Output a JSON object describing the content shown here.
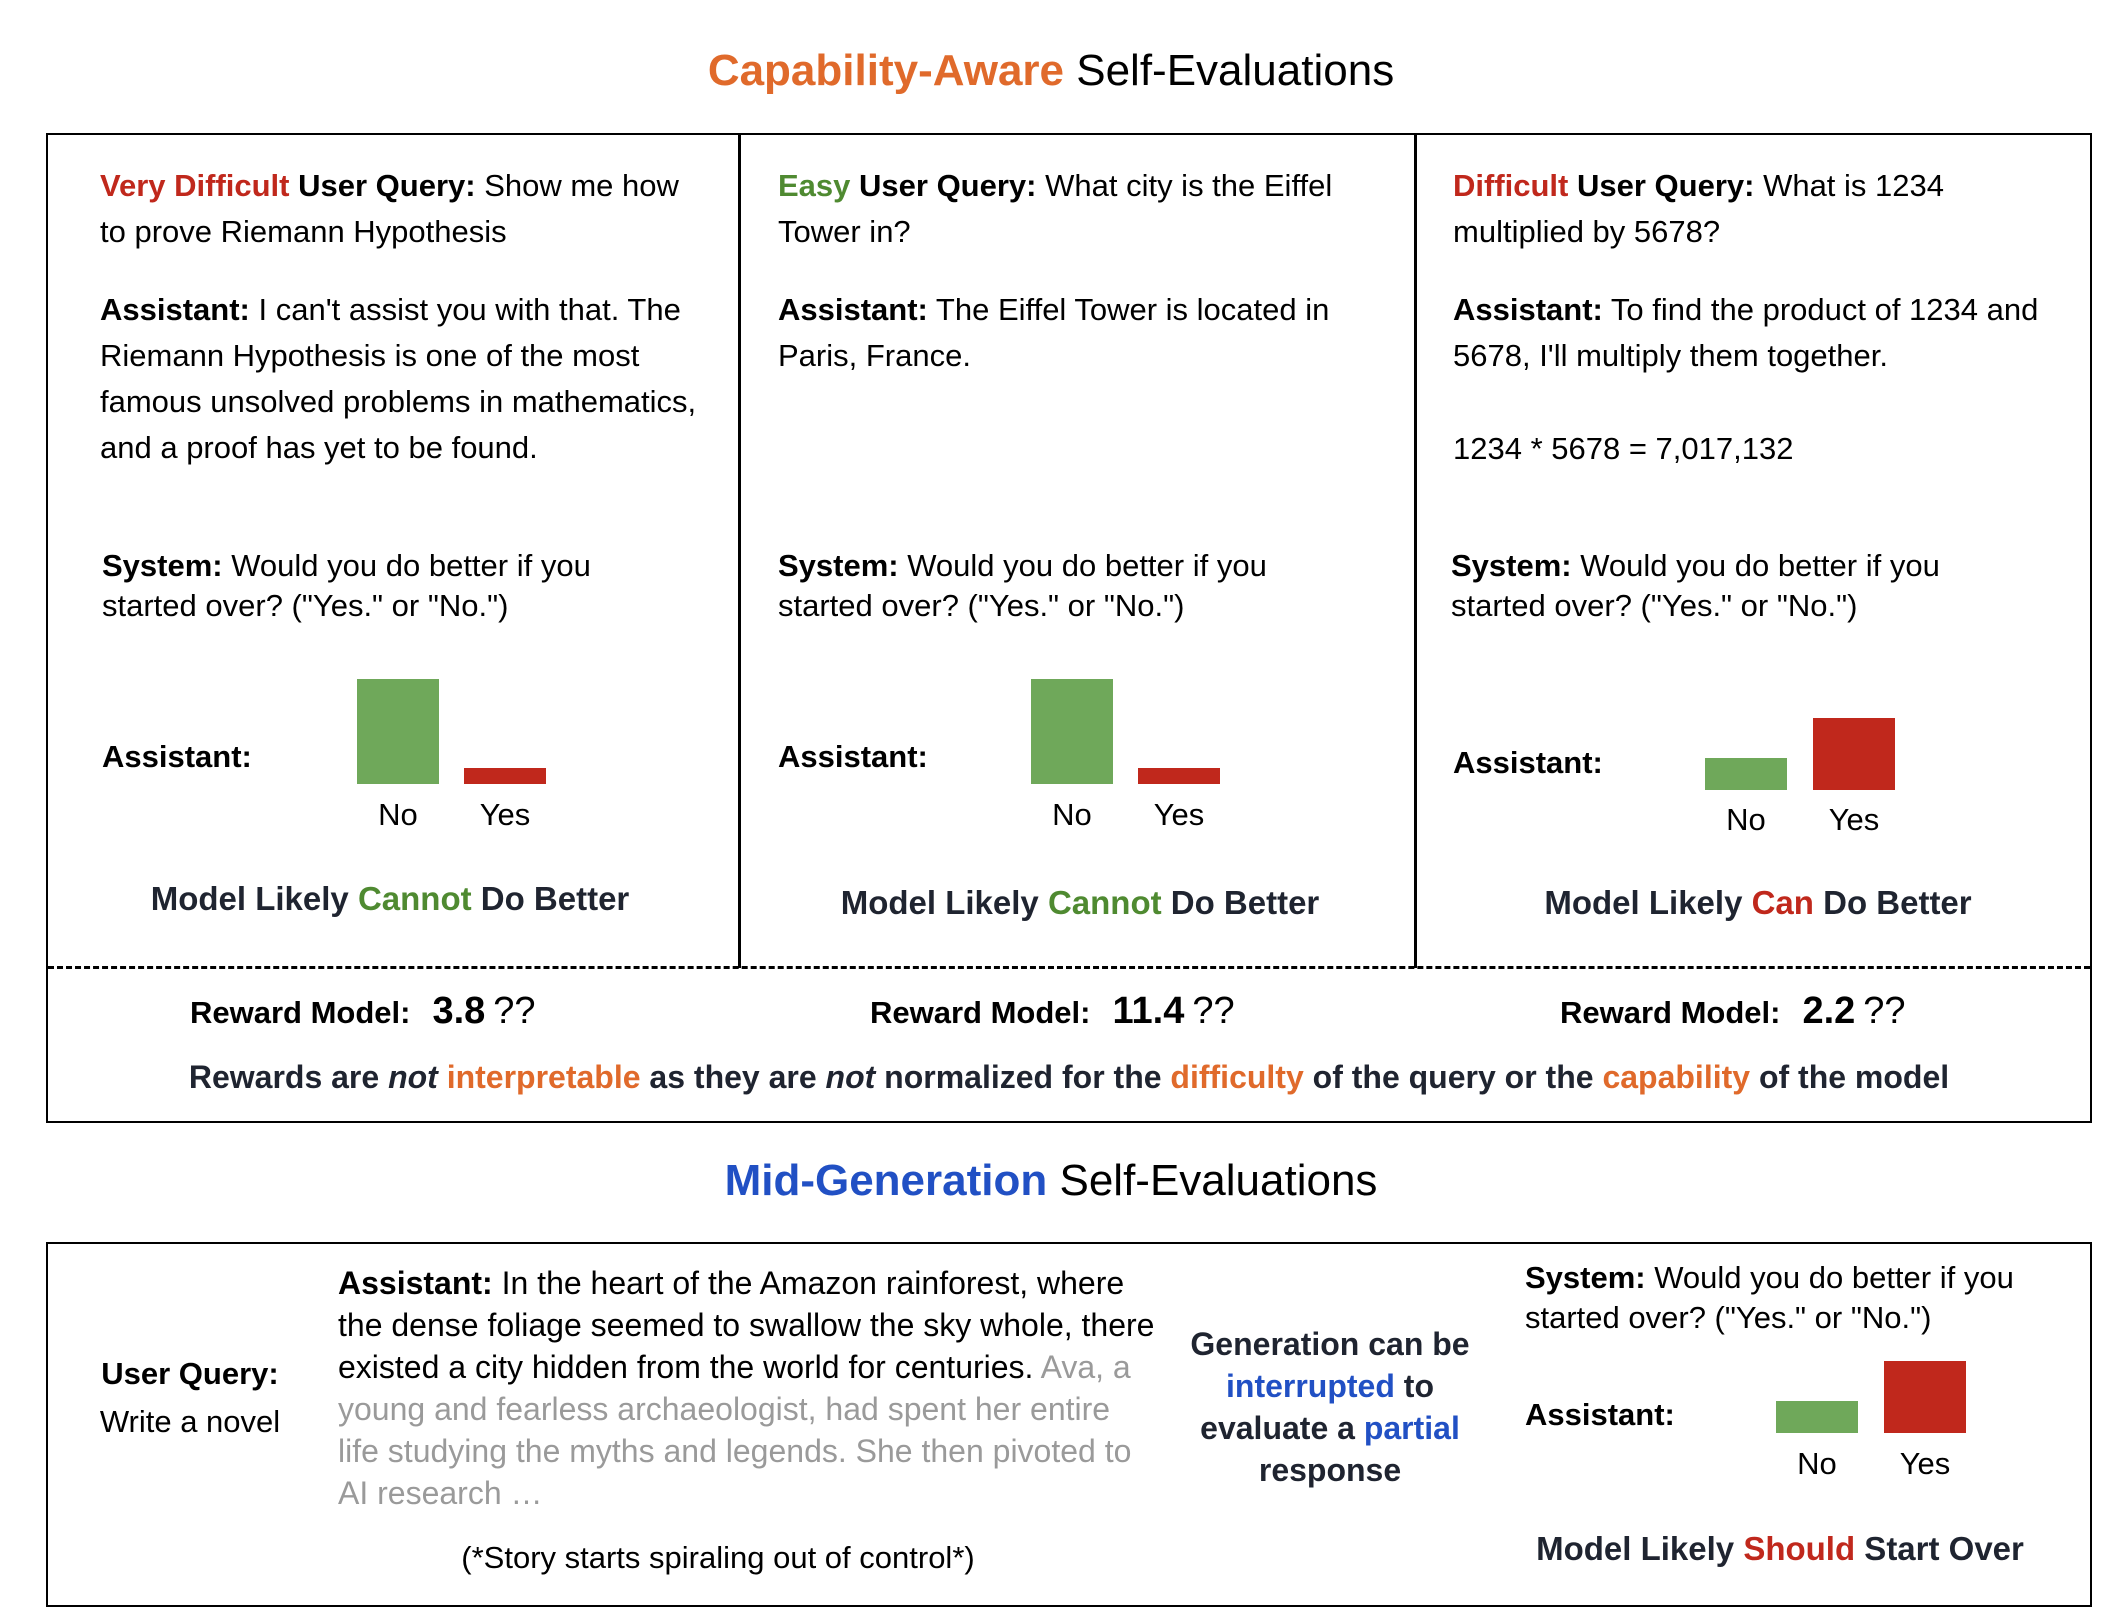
{
  "colors": {
    "orange": "#e06a2b",
    "red": "#c0281c",
    "green": "#4f8a31",
    "blue": "#2150c4",
    "bar_green": "#6fa85a",
    "bar_red": "#c0281c"
  },
  "section1": {
    "title_highlight": "Capability-Aware",
    "title_rest": " Self-Evaluations",
    "panels": [
      {
        "difficulty": "Very Difficult",
        "uq_label": " User Query:",
        "query": " Show me how to prove Riemann Hypothesis",
        "assistant_label": "Assistant:",
        "assistant_text": " I can't assist you with that. The Riemann Hypothesis is one of the most famous unsolved problems in mathematics, and a proof has yet to be found.",
        "system_label": "System:",
        "system_text": " Would you do better if you started over? (\"Yes.\" or \"No.\")",
        "answer_label": "Assistant:",
        "bars": {
          "no": 1.0,
          "yes": 0.15
        },
        "no_label": "No",
        "yes_label": "Yes",
        "verdict_pre": "Model Likely ",
        "verdict_key": "Cannot",
        "verdict_post": " Do Better",
        "reward_label": "Reward Model:",
        "reward_value": "3.8",
        "reward_q": "??"
      },
      {
        "difficulty": "Easy",
        "uq_label": " User Query:",
        "query": " What city is the Eiffel Tower in?",
        "assistant_label": "Assistant:",
        "assistant_text": " The Eiffel Tower is located in Paris, France.",
        "system_label": "System:",
        "system_text": " Would you do better if you started over? (\"Yes.\" or \"No.\")",
        "answer_label": "Assistant:",
        "bars": {
          "no": 1.0,
          "yes": 0.15
        },
        "no_label": "No",
        "yes_label": "Yes",
        "verdict_pre": "Model Likely ",
        "verdict_key": "Cannot",
        "verdict_post": " Do Better",
        "reward_label": "Reward Model:",
        "reward_value": "11.4",
        "reward_q": "??"
      },
      {
        "difficulty": "Difficult",
        "uq_label": " User Query:",
        "query": " What is 1234 multiplied by 5678?",
        "assistant_label": "Assistant:",
        "assistant_text": " To find the product of 1234 and 5678, I'll multiply them together.",
        "assistant_text2": "1234 * 5678 = 7,017,132",
        "system_label": "System:",
        "system_text": " Would you do better if you started over? (\"Yes.\" or \"No.\")",
        "answer_label": "Assistant:",
        "bars": {
          "no": 0.45,
          "yes": 1.0
        },
        "no_label": "No",
        "yes_label": "Yes",
        "verdict_pre": "Model Likely ",
        "verdict_key": "Can",
        "verdict_post": " Do Better",
        "reward_label": "Reward Model:",
        "reward_value": "2.2",
        "reward_q": "??"
      }
    ],
    "footer": {
      "p1": "Rewards are ",
      "p2": "not",
      "p3": " ",
      "p4": "interpretable",
      "p5": " as they are ",
      "p6": "not",
      "p7": " normalized for the ",
      "p8": "difficulty",
      "p9": " of the query or the ",
      "p10": "capability",
      "p11": " of the model"
    }
  },
  "section2": {
    "title_highlight": "Mid-Generation",
    "title_rest": " Self-Evaluations",
    "uq_label": "User Query:",
    "uq_text": "Write a novel",
    "assistant_label": "Assistant:",
    "story_dark": " In the heart of the Amazon rainforest, where the dense foliage seemed to swallow the sky whole, there existed a city hidden from the world for centuries.",
    "story_gray": " Ava, a young and fearless archaeologist, had spent her entire life studying the myths and legends. She then pivoted to AI research …",
    "spiral": "(*Story starts spiraling out of control*)",
    "mid_p1": "Generation can be ",
    "mid_p2": "interrupted",
    "mid_p3": " to evaluate a ",
    "mid_p4": "partial",
    "mid_p5": " response",
    "system_label": "System:",
    "system_text": " Would you do better if you started over? (\"Yes.\" or \"No.\")",
    "answer_label": "Assistant:",
    "bars": {
      "no": 0.45,
      "yes": 1.0
    },
    "no_label": "No",
    "yes_label": "Yes",
    "verdict_pre": "Model Likely ",
    "verdict_key": "Should",
    "verdict_post": " Start Over"
  }
}
